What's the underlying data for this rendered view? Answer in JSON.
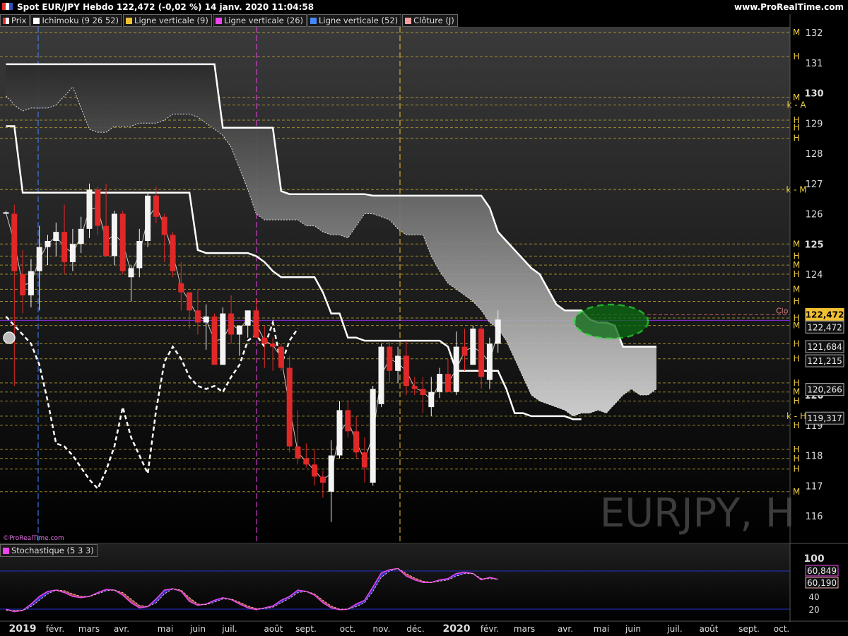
{
  "header": {
    "title": "Spot EUR/JPY Hebdo 122,472 (-0,02 %) 14 janv. 2020 11:04:58",
    "site": "www.ProRealTime.com"
  },
  "legend": [
    {
      "label": "Prix",
      "color": "#e03030"
    },
    {
      "label": "Ichimoku (9 26 52)",
      "color": "#ffffff"
    },
    {
      "label": "Ligne verticale (9)",
      "color": "#f0c030"
    },
    {
      "label": "Ligne verticale (26)",
      "color": "#ee44ee"
    },
    {
      "label": "Ligne verticale (52)",
      "color": "#4488ff"
    },
    {
      "label": "Clôture (J)",
      "color": "#f4a0a0"
    }
  ],
  "credit": "©ProRealTime.com",
  "watermark": "EURJPY, H",
  "stoch_legend": {
    "label": "Stochastique (5 3 3)",
    "color": "#ee44ee"
  },
  "chart_data": [
    {
      "type": "candlestick",
      "title": "Spot EUR/JPY Hebdo",
      "ylim": [
        115.5,
        132.6
      ],
      "y_ticks": [
        116,
        117,
        118,
        119,
        120,
        121,
        122,
        123,
        124,
        125,
        126,
        127,
        128,
        129,
        130,
        131,
        132
      ],
      "y_tick_labels": [
        "116",
        "117",
        "118",
        "119",
        "120",
        "",
        "",
        "",
        "124",
        "125",
        "126",
        "127",
        "128",
        "129",
        "130",
        "131",
        "132"
      ],
      "bold_ticks": [
        120,
        125,
        130
      ],
      "x_labels": [
        "2019",
        "févr.",
        "mars",
        "avr.",
        "mai",
        "juin",
        "juil.",
        "août",
        "sept.",
        "oct.",
        "nov.",
        "déc.",
        "2020",
        "févr.",
        "mars",
        "avr.",
        "mai",
        "juin",
        "juil.",
        "août",
        "sept.",
        "oct."
      ],
      "bold_x_labels": [
        "2019",
        "2020"
      ],
      "candles": [
        {
          "o": 126.0,
          "h": 126.1,
          "l": 126.0,
          "c": 126.05
        },
        {
          "o": 126.0,
          "h": 126.3,
          "l": 120.3,
          "c": 124.1
        },
        {
          "o": 124.0,
          "h": 124.8,
          "l": 122.7,
          "c": 123.3
        },
        {
          "o": 123.3,
          "h": 124.5,
          "l": 122.9,
          "c": 124.1
        },
        {
          "o": 124.1,
          "h": 125.6,
          "l": 122.8,
          "c": 124.9
        },
        {
          "o": 124.9,
          "h": 125.3,
          "l": 124.3,
          "c": 125.1
        },
        {
          "o": 125.1,
          "h": 125.7,
          "l": 124.6,
          "c": 125.4
        },
        {
          "o": 125.4,
          "h": 126.3,
          "l": 124.0,
          "c": 124.4
        },
        {
          "o": 124.4,
          "h": 125.5,
          "l": 124.1,
          "c": 125.0
        },
        {
          "o": 125.0,
          "h": 125.9,
          "l": 124.7,
          "c": 125.5
        },
        {
          "o": 125.5,
          "h": 127.0,
          "l": 125.2,
          "c": 126.8
        },
        {
          "o": 126.8,
          "h": 126.9,
          "l": 125.3,
          "c": 125.6
        },
        {
          "o": 125.6,
          "h": 127.0,
          "l": 125.1,
          "c": 124.6
        },
        {
          "o": 124.6,
          "h": 126.1,
          "l": 124.3,
          "c": 126.0
        },
        {
          "o": 126.0,
          "h": 126.1,
          "l": 124.0,
          "c": 124.1
        },
        {
          "o": 123.9,
          "h": 124.3,
          "l": 123.1,
          "c": 124.2
        },
        {
          "o": 124.2,
          "h": 125.5,
          "l": 123.9,
          "c": 125.1
        },
        {
          "o": 125.1,
          "h": 126.7,
          "l": 124.9,
          "c": 126.6
        },
        {
          "o": 126.6,
          "h": 126.9,
          "l": 125.7,
          "c": 125.9
        },
        {
          "o": 125.9,
          "h": 126.0,
          "l": 124.4,
          "c": 125.3
        },
        {
          "o": 125.3,
          "h": 125.4,
          "l": 123.9,
          "c": 124.1
        },
        {
          "o": 123.7,
          "h": 124.4,
          "l": 122.8,
          "c": 123.4
        },
        {
          "o": 123.4,
          "h": 123.4,
          "l": 122.2,
          "c": 122.8
        },
        {
          "o": 122.8,
          "h": 123.5,
          "l": 122.0,
          "c": 122.4
        },
        {
          "o": 122.4,
          "h": 123.0,
          "l": 121.5,
          "c": 122.6
        },
        {
          "o": 122.6,
          "h": 122.7,
          "l": 121.2,
          "c": 121.0
        },
        {
          "o": 121.0,
          "h": 122.9,
          "l": 121.0,
          "c": 122.7
        },
        {
          "o": 122.7,
          "h": 123.3,
          "l": 121.7,
          "c": 122.0
        },
        {
          "o": 122.0,
          "h": 122.3,
          "l": 121.3,
          "c": 122.3
        },
        {
          "o": 122.3,
          "h": 122.8,
          "l": 121.9,
          "c": 122.8
        },
        {
          "o": 122.8,
          "h": 123.2,
          "l": 121.9,
          "c": 121.9
        },
        {
          "o": 121.9,
          "h": 122.3,
          "l": 120.9,
          "c": 121.7
        },
        {
          "o": 121.7,
          "h": 121.9,
          "l": 120.8,
          "c": 121.6
        },
        {
          "o": 121.6,
          "h": 121.7,
          "l": 120.8,
          "c": 120.9
        },
        {
          "o": 120.9,
          "h": 121.3,
          "l": 118.1,
          "c": 118.3
        },
        {
          "o": 118.3,
          "h": 119.5,
          "l": 117.7,
          "c": 117.9
        },
        {
          "o": 117.9,
          "h": 118.4,
          "l": 117.6,
          "c": 117.7
        },
        {
          "o": 117.7,
          "h": 118.2,
          "l": 117.0,
          "c": 117.3
        },
        {
          "o": 117.3,
          "h": 117.5,
          "l": 116.6,
          "c": 117.1
        },
        {
          "o": 116.8,
          "h": 118.5,
          "l": 115.8,
          "c": 118.0
        },
        {
          "o": 118.0,
          "h": 119.8,
          "l": 117.9,
          "c": 119.5
        },
        {
          "o": 119.5,
          "h": 119.8,
          "l": 118.6,
          "c": 118.8
        },
        {
          "o": 118.8,
          "h": 119.3,
          "l": 117.9,
          "c": 118.1
        },
        {
          "o": 118.1,
          "h": 118.6,
          "l": 117.1,
          "c": 117.6
        },
        {
          "o": 117.1,
          "h": 120.3,
          "l": 117.0,
          "c": 120.2
        },
        {
          "o": 119.7,
          "h": 121.7,
          "l": 119.6,
          "c": 121.6
        },
        {
          "o": 121.6,
          "h": 121.8,
          "l": 120.4,
          "c": 120.8
        },
        {
          "o": 120.8,
          "h": 121.6,
          "l": 120.4,
          "c": 121.3
        },
        {
          "o": 121.3,
          "h": 121.8,
          "l": 120.0,
          "c": 120.3
        },
        {
          "o": 120.3,
          "h": 120.6,
          "l": 120.0,
          "c": 120.2
        },
        {
          "o": 120.2,
          "h": 120.6,
          "l": 119.4,
          "c": 120.0
        },
        {
          "o": 119.6,
          "h": 120.6,
          "l": 119.3,
          "c": 120.1
        },
        {
          "o": 120.1,
          "h": 120.9,
          "l": 119.9,
          "c": 120.7
        },
        {
          "o": 120.7,
          "h": 121.2,
          "l": 120.1,
          "c": 120.1
        },
        {
          "o": 120.1,
          "h": 122.1,
          "l": 120.0,
          "c": 121.6
        },
        {
          "o": 121.6,
          "h": 122.2,
          "l": 120.8,
          "c": 121.3
        },
        {
          "o": 121.0,
          "h": 122.3,
          "l": 121.0,
          "c": 122.2
        },
        {
          "o": 122.2,
          "h": 122.3,
          "l": 120.2,
          "c": 120.6
        },
        {
          "o": 120.5,
          "h": 121.9,
          "l": 120.2,
          "c": 121.7
        },
        {
          "o": 121.7,
          "h": 122.8,
          "l": 121.4,
          "c": 122.5
        }
      ],
      "kijun": [
        130.95,
        130.95,
        130.95,
        130.95,
        130.95,
        130.95,
        130.95,
        130.95,
        130.95,
        130.95,
        130.95,
        130.95,
        130.95,
        130.95,
        130.95,
        130.95,
        130.95,
        130.95,
        130.95,
        130.95,
        130.95,
        130.95,
        130.95,
        130.95,
        130.95,
        130.95,
        128.85,
        128.85,
        128.85,
        128.85,
        128.85,
        128.85,
        128.85,
        126.75,
        126.65,
        126.65,
        126.65,
        126.65,
        126.65,
        126.65,
        126.65,
        126.65,
        126.65,
        126.65,
        126.6,
        126.6,
        126.6,
        126.6,
        126.6,
        126.6,
        126.6,
        126.6,
        126.6,
        126.6,
        126.6,
        126.6,
        126.6,
        126.6,
        126.2,
        125.4,
        125.1,
        124.8,
        124.5,
        124.2,
        124.0,
        123.5,
        123.0,
        122.8,
        122.8,
        122.8,
        122.5,
        122.4,
        122.4,
        122.3,
        121.6,
        121.6,
        121.6,
        121.6,
        121.6
      ],
      "tenkan": [
        128.9,
        128.9,
        126.7,
        126.7,
        126.7,
        126.7,
        126.7,
        126.7,
        126.7,
        126.7,
        126.7,
        126.7,
        126.7,
        126.7,
        126.7,
        126.7,
        126.7,
        126.7,
        126.7,
        126.7,
        126.7,
        126.7,
        126.7,
        124.8,
        124.7,
        124.7,
        124.7,
        124.7,
        124.7,
        124.7,
        124.6,
        124.4,
        124.1,
        123.9,
        123.9,
        123.9,
        123.9,
        123.9,
        123.4,
        122.7,
        122.7,
        121.9,
        121.9,
        121.8,
        121.8,
        121.8,
        121.8,
        121.8,
        121.8,
        121.8,
        121.8,
        121.8,
        121.8,
        121.6,
        120.8,
        120.8,
        120.8,
        120.8,
        120.8,
        120.8,
        120.2,
        119.4,
        119.4,
        119.3,
        119.3,
        119.3,
        119.3,
        119.3,
        119.2,
        119.2
      ],
      "senkou_a": [
        130.95,
        130.95,
        130.95,
        130.95,
        130.95,
        130.95,
        130.95,
        130.95,
        130.95,
        130.95,
        130.95,
        130.95,
        130.95,
        130.95,
        130.95,
        130.95,
        130.95,
        130.95,
        130.95,
        130.95,
        130.95,
        130.95,
        130.95,
        130.95,
        130.95,
        130.95,
        128.85,
        128.85,
        128.85,
        128.85,
        128.85,
        128.85,
        128.85,
        126.75,
        126.65,
        126.65,
        126.65,
        126.65,
        126.65,
        126.65,
        126.65,
        126.65,
        126.65,
        126.65,
        126.6,
        126.6,
        126.6,
        126.6,
        126.6,
        126.6,
        126.6,
        126.6,
        126.6,
        126.6,
        126.6,
        126.6,
        126.6,
        126.6,
        126.2,
        125.4,
        125.1,
        124.8,
        124.5,
        124.2,
        124.0,
        123.5,
        123.0,
        122.8,
        122.8,
        122.8,
        122.5,
        122.4,
        122.4,
        122.3,
        121.6,
        121.6,
        121.6,
        121.6,
        121.6
      ],
      "senkou_b": [
        129.9,
        129.6,
        129.4,
        129.5,
        129.5,
        129.5,
        129.6,
        129.9,
        130.2,
        129.5,
        128.8,
        128.7,
        128.7,
        128.9,
        128.9,
        128.9,
        129.0,
        129.0,
        129.0,
        129.1,
        129.3,
        129.3,
        129.3,
        129.2,
        129.0,
        128.8,
        128.6,
        128.2,
        127.5,
        126.8,
        126.0,
        125.8,
        125.8,
        125.8,
        125.8,
        125.8,
        125.6,
        125.6,
        125.4,
        125.3,
        125.3,
        125.2,
        125.6,
        126.0,
        126.0,
        125.9,
        125.8,
        125.5,
        125.3,
        125.3,
        125.3,
        124.6,
        124.1,
        123.7,
        123.5,
        123.3,
        123.1,
        122.8,
        122.4,
        122.2,
        121.8,
        121.2,
        120.6,
        120.0,
        119.8,
        119.7,
        119.6,
        119.5,
        119.3,
        119.4,
        119.4,
        119.5,
        119.4,
        119.7,
        120.0,
        120.2,
        120.0,
        120.0,
        120.2
      ],
      "chikou": [
        122.6,
        122.3,
        122.0,
        121.7,
        121.0,
        119.8,
        118.4,
        118.3,
        118.0,
        117.6,
        117.2,
        116.9,
        117.5,
        118.3,
        119.6,
        118.6,
        118.0,
        117.4,
        119.5,
        121.1,
        121.6,
        121.2,
        120.6,
        120.3,
        120.2,
        120.3,
        120.1,
        120.6,
        121.0,
        121.8,
        122.0,
        121.6,
        122.4,
        121.0,
        121.8,
        122.2
      ],
      "levels": [
        {
          "y": 132.0,
          "tag": "M"
        },
        {
          "y": 131.2,
          "tag": "H"
        },
        {
          "y": 129.85,
          "tag": "M"
        },
        {
          "y": 129.6,
          "tag": "k - A"
        },
        {
          "y": 129.1,
          "tag": "H"
        },
        {
          "y": 128.85,
          "tag": "H"
        },
        {
          "y": 128.5,
          "tag": "H"
        },
        {
          "y": 126.8,
          "tag": "k - M"
        },
        {
          "y": 125.0,
          "tag": "M"
        },
        {
          "y": 124.6,
          "tag": "H"
        },
        {
          "y": 124.3,
          "tag": "M"
        },
        {
          "y": 124.0,
          "tag": "H"
        },
        {
          "y": 123.5,
          "tag": "M"
        },
        {
          "y": 123.1,
          "tag": "H"
        },
        {
          "y": 122.55,
          "tag": "H"
        },
        {
          "y": 122.3,
          "tag": "M"
        },
        {
          "y": 121.7,
          "tag": "H"
        },
        {
          "y": 121.2,
          "tag": "H"
        },
        {
          "y": 120.4,
          "tag": "H"
        },
        {
          "y": 120.1,
          "tag": "M"
        },
        {
          "y": 119.8,
          "tag": "H"
        },
        {
          "y": 119.3,
          "tag": "k - H"
        },
        {
          "y": 119.0,
          "tag": "H"
        },
        {
          "y": 118.2,
          "tag": "H"
        },
        {
          "y": 117.9,
          "tag": "H"
        },
        {
          "y": 117.55,
          "tag": "H"
        },
        {
          "y": 116.8,
          "tag": "M"
        }
      ],
      "price_boxes": [
        {
          "value": "122,472",
          "style": "current"
        },
        {
          "value": "122,472",
          "style": "dark"
        },
        {
          "value": "121,684",
          "style": "dark"
        },
        {
          "value": "121,215",
          "style": "dark"
        },
        {
          "value": "120,266",
          "style": "dark"
        },
        {
          "value": "119,317",
          "style": "dark"
        }
      ],
      "close_label": "Clo",
      "close_value": 122.47
    },
    {
      "type": "line",
      "title": "Stochastique (5 3 3)",
      "ylim": [
        0,
        110
      ],
      "y_ticks": [
        20,
        40,
        60,
        80,
        100
      ],
      "y_tick_labels": [
        "20",
        "40",
        "60",
        "80",
        "100"
      ],
      "bands": [
        20,
        80
      ],
      "k": [
        20,
        16,
        18,
        28,
        40,
        48,
        50,
        46,
        40,
        38,
        40,
        46,
        51,
        50,
        42,
        30,
        22,
        24,
        36,
        50,
        52,
        48,
        32,
        26,
        28,
        34,
        38,
        35,
        28,
        22,
        19,
        22,
        25,
        34,
        40,
        50,
        48,
        42,
        30,
        22,
        19,
        20,
        28,
        34,
        55,
        77,
        82,
        84,
        72,
        66,
        62,
        62,
        66,
        68,
        76,
        78,
        76,
        66,
        70,
        67
      ],
      "d": [
        18,
        18,
        18,
        24,
        34,
        44,
        50,
        49,
        44,
        40,
        40,
        44,
        49,
        50,
        46,
        36,
        26,
        24,
        30,
        44,
        52,
        50,
        38,
        28,
        27,
        31,
        36,
        36,
        31,
        25,
        21,
        21,
        23,
        30,
        37,
        46,
        48,
        44,
        34,
        25,
        20,
        20,
        24,
        30,
        48,
        70,
        80,
        84,
        76,
        69,
        64,
        62,
        64,
        66,
        72,
        76,
        76,
        68,
        68,
        67
      ],
      "k_value": "60,849",
      "d_value": "60,190"
    }
  ]
}
